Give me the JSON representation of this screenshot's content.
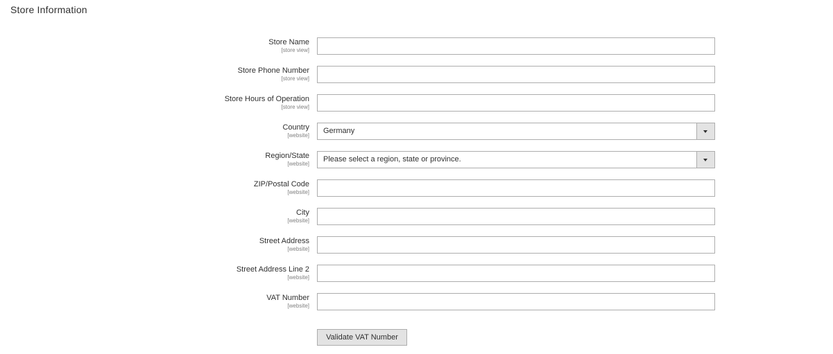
{
  "section": {
    "title": "Store Information"
  },
  "fields": [
    {
      "label": "Store Name",
      "scope": "[store view]",
      "type": "text",
      "value": ""
    },
    {
      "label": "Store Phone Number",
      "scope": "[store view]",
      "type": "text",
      "value": ""
    },
    {
      "label": "Store Hours of Operation",
      "scope": "[store view]",
      "type": "text",
      "value": ""
    },
    {
      "label": "Country",
      "scope": "[website]",
      "type": "select",
      "value": "Germany"
    },
    {
      "label": "Region/State",
      "scope": "[website]",
      "type": "select",
      "value": "Please select a region, state or province."
    },
    {
      "label": "ZIP/Postal Code",
      "scope": "[website]",
      "type": "text",
      "value": ""
    },
    {
      "label": "City",
      "scope": "[website]",
      "type": "text",
      "value": ""
    },
    {
      "label": "Street Address",
      "scope": "[website]",
      "type": "text",
      "value": ""
    },
    {
      "label": "Street Address Line 2",
      "scope": "[website]",
      "type": "text",
      "value": ""
    },
    {
      "label": "VAT Number",
      "scope": "[website]",
      "type": "text",
      "value": ""
    }
  ],
  "actions": {
    "validate_vat_label": "Validate VAT Number"
  },
  "icons": {
    "select_arrow": "chevron-down-icon"
  }
}
